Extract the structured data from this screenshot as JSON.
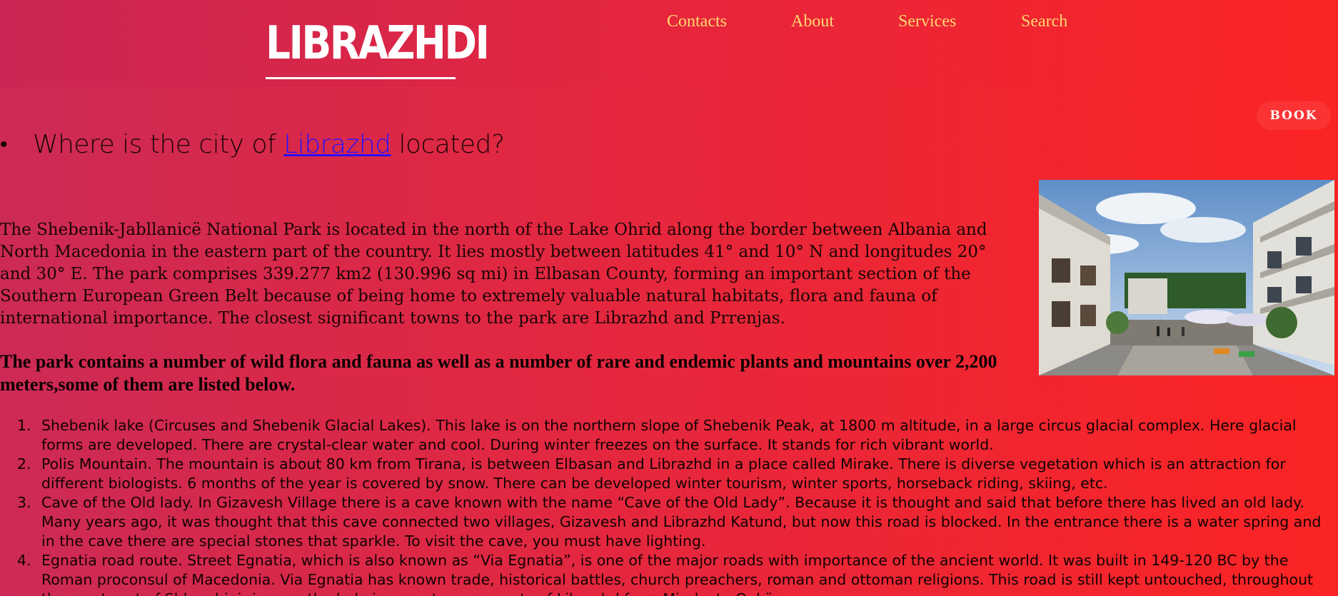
{
  "header": {
    "logo": "LIBRAZHDI",
    "nav": [
      "Contacts",
      "About",
      "Services",
      "Search"
    ]
  },
  "book_button": "BOOK",
  "question": {
    "before": "Where is the city of ",
    "link": "Librazhd",
    "after": " located?"
  },
  "intro": "The Shebenik-Jabllanicë National Park is located in the north of the Lake Ohrid along the border between Albania and North Macedonia in the eastern part of the country. It lies mostly between latitudes 41° and 10° N and longitudes 20° and 30° E. The park comprises 339.277 km2 (130.996 sq mi) in Elbasan County, forming an important section of the Southern European Green Belt because of being home to extremely valuable natural habitats, flora and fauna of international importance. The closest significant towns to the park are Librazhd and Prrenjas.",
  "bold_paragraph": "The park contains a number of wild flora and fauna as well as a number of rare and endemic plants and mountains over 2,200 meters,some of them are listed below.",
  "sites": [
    "Shebenik lake (Circuses and Shebenik Glacial Lakes). This lake is on the northern slope of Shebenik Peak, at 1800 m altitude, in a large circus glacial complex. Here glacial forms are developed. There are crystal-clear water and cool. During winter freezes on the surface. It stands for rich vibrant world.",
    "Polis Mountain. The mountain is about 80 km from Tirana, is between Elbasan and Librazhd in a place called Mirake. There is diverse vegetation which is an attraction for different biologists. 6 months of the year is covered by snow. There can be developed winter tourism, winter sports, horseback riding, skiing, etc.",
    "Cave of the Old lady. In Gizavesh Village there is a cave known with the name “Cave of the Old Lady”. Because it is thought and said that before there has lived an old lady. Many years ago, it was thought that this cave connected two villages, Gizavesh and Librazhd Katund, but now this road is blocked. In the entrance there is a water spring and in the cave there are special stones that sparkle. To visit the cave, you must have lighting.",
    "Egnatia road route. Street Egnatia, which is also known as “Via Egnatia”, is one of the major roads with importance of the ancient world. It was built in 149-120 BC by the Roman proconsul of Macedonia. Via Egnatia has known trade, historical battles, church preachers, roman and ottoman religions. This road is still kept untouched, throughout the most part of Shkumbini river on the hole journey to some parts of Librazhd from Mirake to Qukës."
  ]
}
